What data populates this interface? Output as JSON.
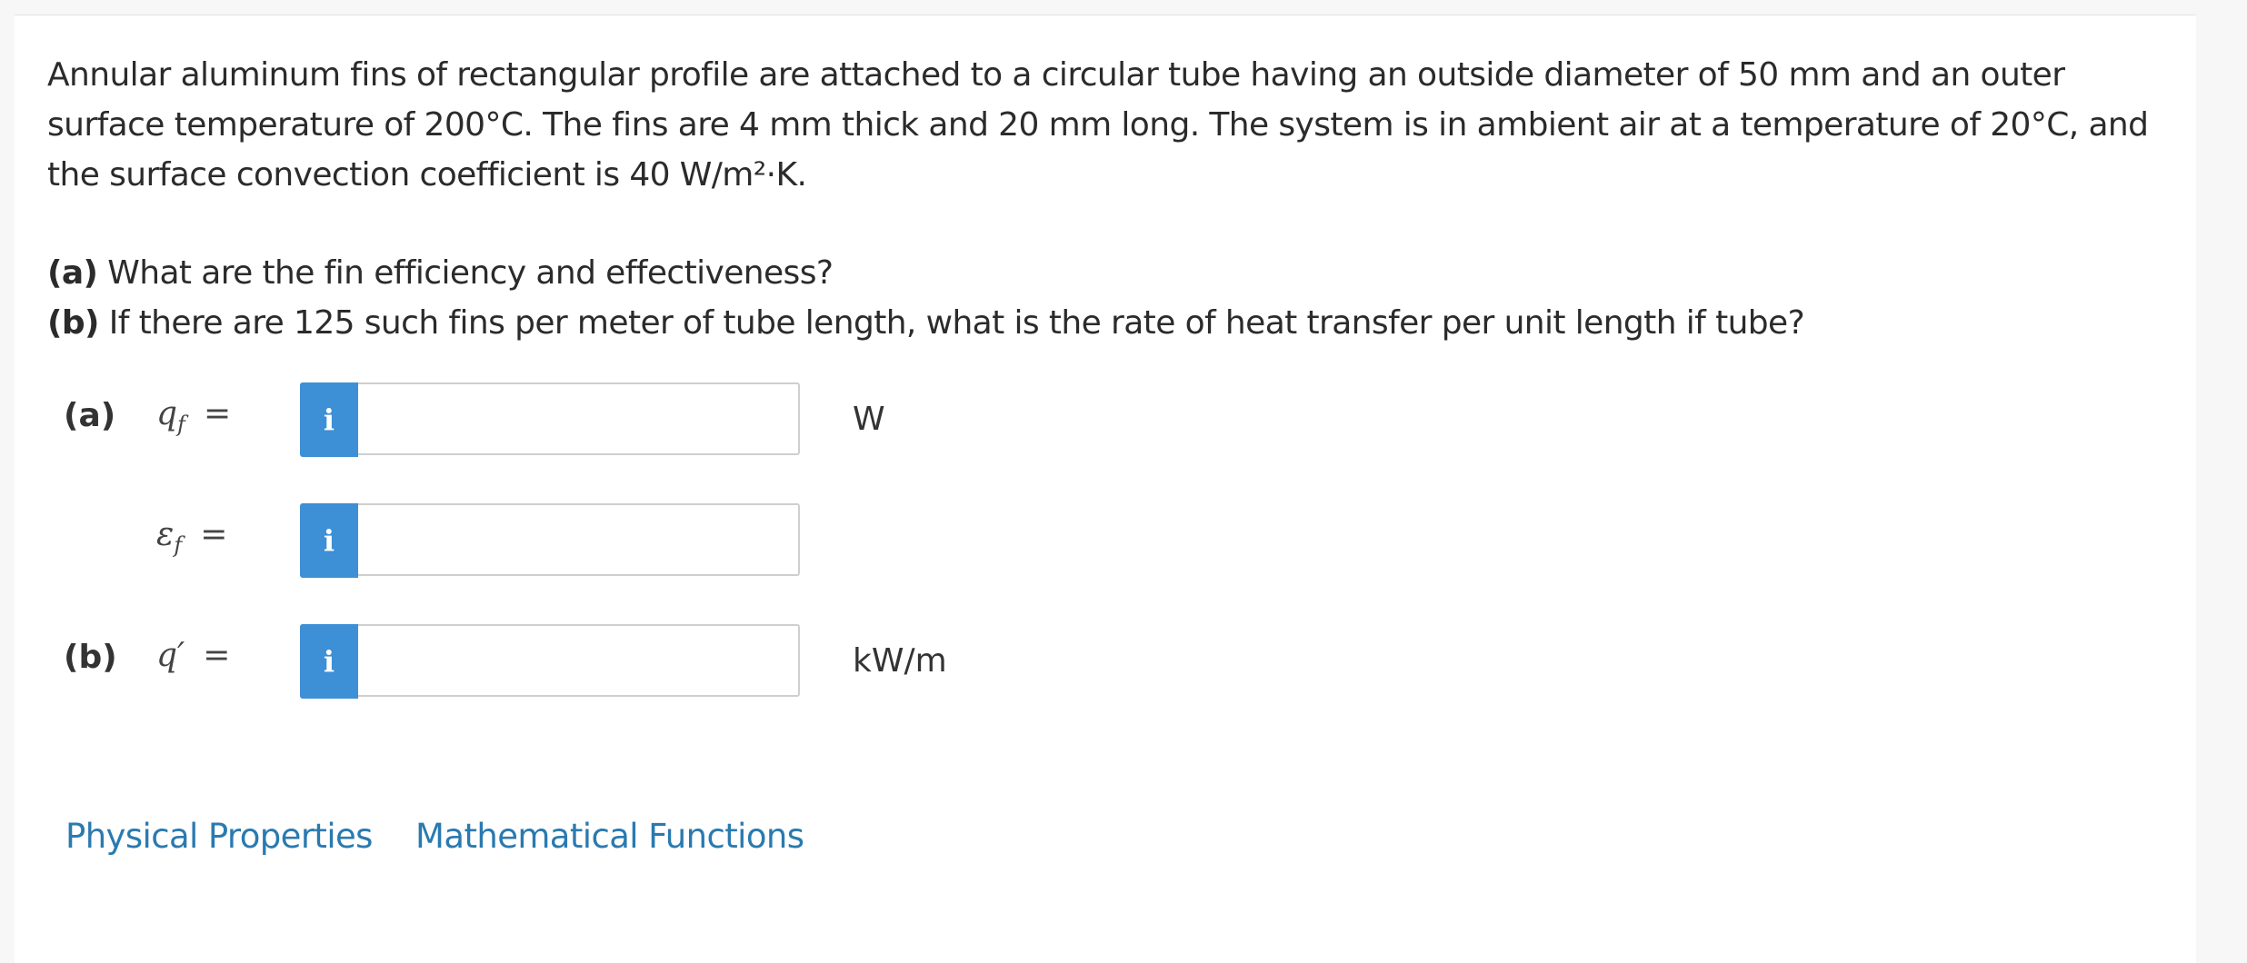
{
  "problem": {
    "statement": "Annular aluminum fins of rectangular profile are attached to a circular tube having an outside diameter of 50 mm and an outer surface temperature of 200°C. The fins are 4 mm thick and 20 mm long. The system is in ambient air at a temperature of 20°C, and the surface convection coefficient is 40 W/m²·K.",
    "part_a_label": "(a)",
    "part_a_text": "What are the fin efficiency and effectiveness?",
    "part_b_label": "(b)",
    "part_b_text": "If there are 125 such fins per meter of tube length, what is the rate of heat transfer per unit length if tube?"
  },
  "answers": [
    {
      "part": "(a)",
      "variable": "q",
      "subscript": "f",
      "equals": "=",
      "info_icon": "info-icon",
      "info_glyph": "i",
      "value": "",
      "unit": "W"
    },
    {
      "part": "",
      "variable": "ε",
      "subscript": "f",
      "equals": "=",
      "info_icon": "info-icon",
      "info_glyph": "i",
      "value": "",
      "unit": ""
    },
    {
      "part": "(b)",
      "variable": "q′",
      "subscript": "",
      "equals": "=",
      "info_icon": "info-icon",
      "info_glyph": "i",
      "value": "",
      "unit": "kW/m"
    }
  ],
  "links": {
    "physical_properties": "Physical Properties",
    "mathematical_functions": "Mathematical Functions"
  },
  "colors": {
    "info_button": "#3d8fd6",
    "link": "#2a7ab0"
  }
}
